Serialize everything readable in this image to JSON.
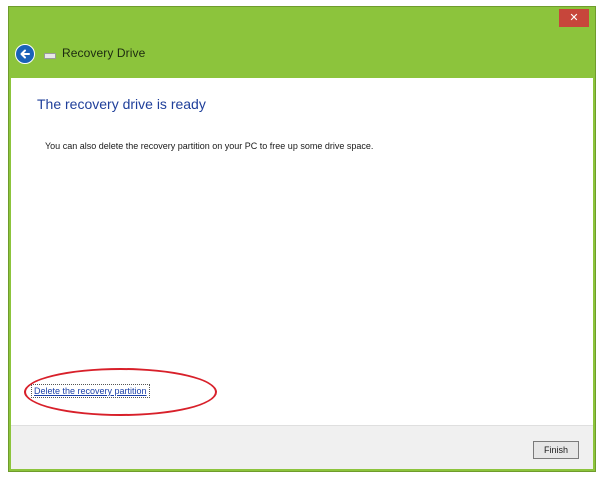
{
  "window": {
    "close_glyph": "✕",
    "title": "Recovery Drive"
  },
  "content": {
    "heading": "The recovery drive is ready",
    "description": "You can also delete the recovery partition on your PC to free up some drive space.",
    "delete_link": "Delete the recovery partition"
  },
  "footer": {
    "finish_label": "Finish"
  },
  "icons": {
    "back": "back-arrow-icon",
    "drive": "drive-icon",
    "close": "close-icon"
  },
  "colors": {
    "accent": "#8cc43c",
    "heading": "#1f3f9a",
    "link": "#1a3fa8",
    "close": "#c7463b",
    "highlight": "#d8202a",
    "back_button": "#1a62b8"
  }
}
